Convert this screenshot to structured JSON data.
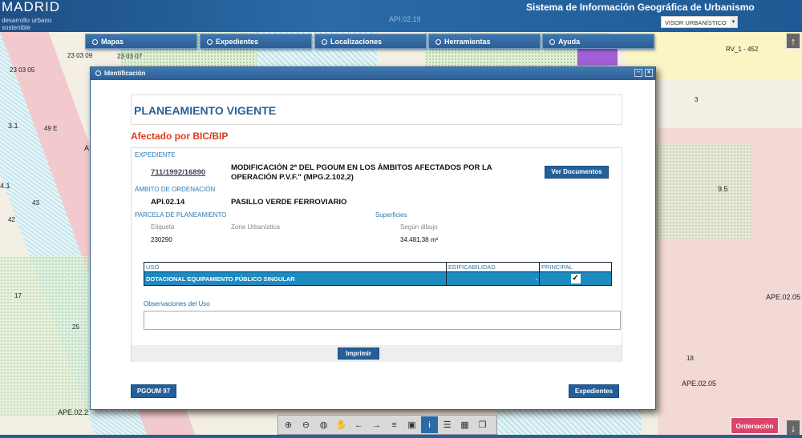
{
  "header": {
    "logo": "MADRID",
    "logo_sub_1": "desarrollo urbano",
    "logo_sub_2": "sostenible",
    "title": "Sistema de Información Geográfica de Urbanismo",
    "visor_select": "VISOR URBANÍSTICO"
  },
  "nav": [
    {
      "label": "Mapas"
    },
    {
      "label": "Expedientes"
    },
    {
      "label": "Localizaciones"
    },
    {
      "label": "Herramientas"
    },
    {
      "label": "Ayuda"
    }
  ],
  "map_labels": [
    "API.02.19",
    "23 03 09",
    "23 03 07",
    "23 03 05",
    "3.1",
    "49 E",
    "RV_1 - 452",
    "3",
    "9.5",
    "APE.02.05",
    "APE.02.05",
    "APE.02.2",
    "18",
    "17",
    "25",
    "42",
    "43",
    "4.1",
    "A"
  ],
  "dialog": {
    "title": "Identificación",
    "heading": "PLANEAMIENTO VIGENTE",
    "affected": "Afectado por BIC/BIP",
    "expediente_label": "EXPEDIENTE",
    "expediente_id": "711/1992/16890",
    "expediente_desc_1": "MODIFICACIÓN 2ª DEL PGOUM EN LOS ÁMBITOS AFECTADOS POR LA",
    "expediente_desc_2": "OPERACIÓN P.V.F.\" (MPG.2.102,2)",
    "ver_documentos": "Ver Documentos",
    "ambito_label": "ÁMBITO DE ORDENACIÓN",
    "ambito_code": "API.02.14",
    "ambito_name": "PASILLO VERDE FERROVIARIO",
    "parcela_label": "PARCELA DE PLANEAMIENTO",
    "superficies_label": "Superficies",
    "etiqueta_label": "Etiqueta",
    "zona_label": "Zona Urbanística",
    "segun_label": "Según dibujo",
    "etiqueta_val": "230290",
    "segun_val": "34.481,38 m²",
    "table": {
      "headers": [
        "USO",
        "EDIFICABILIDAD",
        "PRINCIPAL"
      ],
      "rows": [
        {
          "uso": "DOTACIONAL EQUIPAMIENTO PÚBLICO SINGULAR",
          "edificabilidad": "-",
          "principal": "✓"
        }
      ]
    },
    "observaciones_label": "Observaciones del Uso",
    "observaciones_value": "",
    "imprimir": "Imprimir",
    "pgoum": "PGOUM 97",
    "expedientes": "Expedientes"
  },
  "toolbar": [
    "zoom-in",
    "zoom-out",
    "globe",
    "pan",
    "back",
    "forward",
    "legend",
    "overview",
    "info",
    "list",
    "grid",
    "layers"
  ],
  "ordenacion": "Ordenación"
}
